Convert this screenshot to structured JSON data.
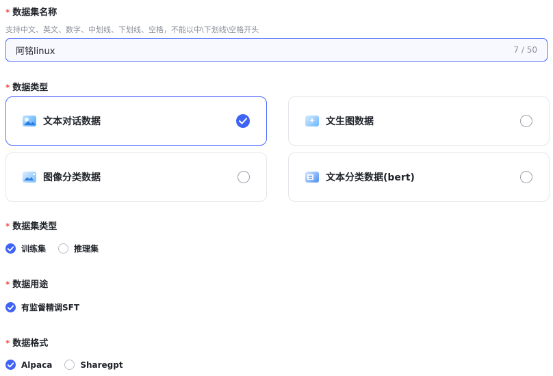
{
  "dataset_name": {
    "label": "数据集名称",
    "hint": "支持中文、英文、数字、中划线、下划线、空格，不能以中\\下划线\\空格开头",
    "value": "阿铭linux",
    "counter": "7 / 50"
  },
  "data_type": {
    "label": "数据类型",
    "options": [
      {
        "label": "文本对话数据",
        "icon": "chat-image-icon",
        "selected": true
      },
      {
        "label": "文生图数据",
        "icon": "text-to-image-icon",
        "selected": false
      },
      {
        "label": "图像分类数据",
        "icon": "image-classify-icon",
        "selected": false
      },
      {
        "label": "文本分类数据(bert)",
        "icon": "text-classify-icon",
        "selected": false
      }
    ]
  },
  "dataset_type": {
    "label": "数据集类型",
    "options": [
      {
        "label": "训练集",
        "selected": true
      },
      {
        "label": "推理集",
        "selected": false
      }
    ]
  },
  "data_usage": {
    "label": "数据用途",
    "options": [
      {
        "label": "有监督精调SFT",
        "selected": true
      }
    ]
  },
  "data_format": {
    "label": "数据格式",
    "options": [
      {
        "label": "Alpaca",
        "selected": true
      },
      {
        "label": "Sharegpt",
        "selected": false
      }
    ]
  },
  "colors": {
    "accent": "#3f63f5",
    "required": "#f54a45"
  }
}
